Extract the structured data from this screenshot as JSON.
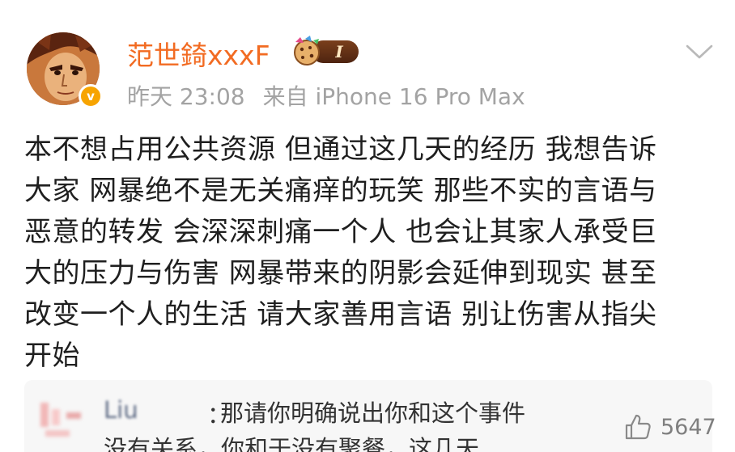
{
  "post": {
    "username": "范世錡xxxF",
    "level_badge": "I",
    "verified_mark": "v",
    "time": "昨天 23:08",
    "source": "来自 iPhone 16 Pro Max",
    "content": "本不想占用公共资源 但通过这几天的经历 我想告诉\n大家 网暴绝不是无关痛痒的玩笑 那些不实的言语与\n恶意的转发 会深深刺痛一个人 也会让其家人承受巨\n大的压力与伤害 网暴带来的阴影会延伸到现实 甚至\n改变一个人的生活 请大家善用言语 别让伤害从指尖\n开始"
  },
  "comment": {
    "author": "Liu",
    "colon": "：",
    "text_line1": "那请你明确说出你和这个事件",
    "text_line2": "没有关系，你和于没有聚餐，这几天...",
    "likes": "5647"
  },
  "icons": {
    "menu": "chevron-down-icon",
    "like": "thumbs-up-icon",
    "verified": "verified-badge-icon"
  },
  "colors": {
    "username": "#f26b22",
    "meta": "#a3a3a3",
    "verified": "#f7a400"
  }
}
